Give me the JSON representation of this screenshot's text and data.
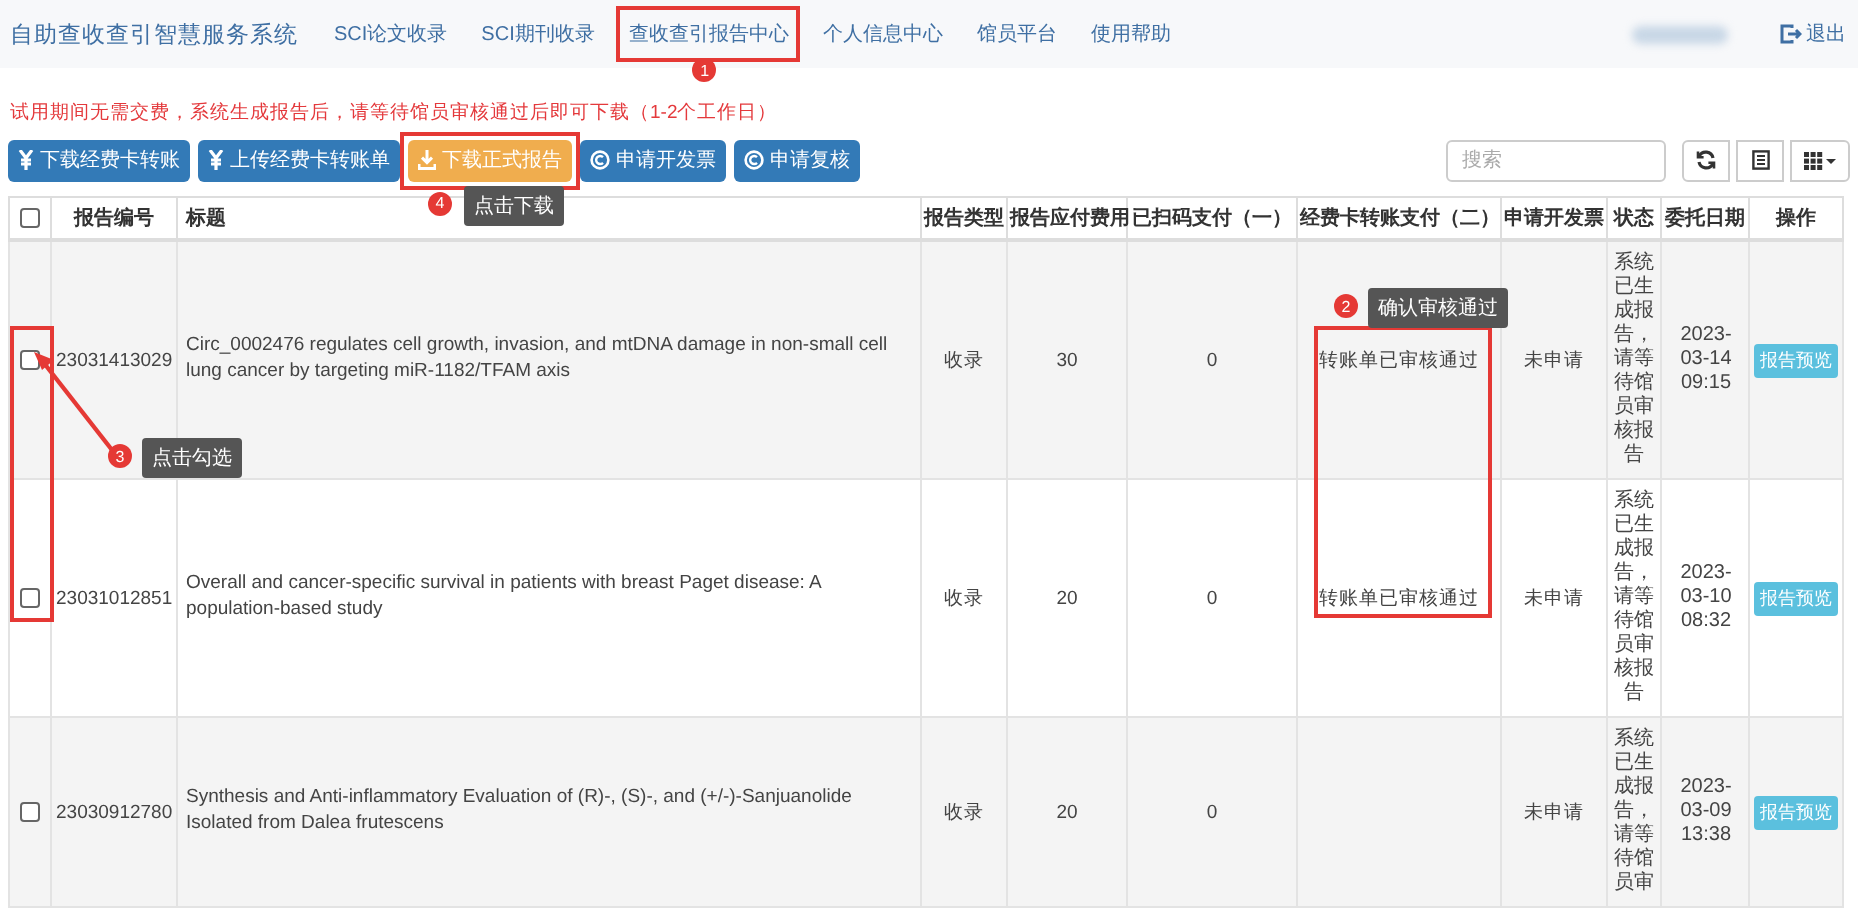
{
  "navbar": {
    "brand": "自助查收查引智慧服务系统",
    "items": [
      {
        "label": "SCI论文收录"
      },
      {
        "label": "SCI期刊收录"
      },
      {
        "label": "查收查引报告中心",
        "annotation": {
          "number": "1"
        }
      },
      {
        "label": "个人信息中心"
      },
      {
        "label": "馆员平台"
      },
      {
        "label": "使用帮助"
      }
    ],
    "logout": "退出"
  },
  "notice": "试用期间无需交费，系统生成报告后，请等待馆员审核通过后即可下载（1-2个工作日）",
  "toolbar": {
    "buttons": [
      {
        "label": "下载经费卡转账",
        "kind": "yen",
        "color": "#337ab7"
      },
      {
        "label": "上传经费卡转账单",
        "kind": "yen",
        "color": "#337ab7"
      },
      {
        "label": "下载正式报告",
        "kind": "download",
        "color": "#f0ad4e",
        "annotation": {
          "number": "4",
          "tip": "点击下载"
        }
      },
      {
        "label": "申请开发票",
        "kind": "circle",
        "color": "#337ab7"
      },
      {
        "label": "申请复核",
        "kind": "circle",
        "color": "#337ab7"
      }
    ],
    "search": {
      "placeholder": "搜索"
    }
  },
  "table": {
    "header_checkbox": {
      "checked": false
    },
    "columns": [
      "报告编号",
      "标题",
      "报告类型",
      "报告应付费用",
      "已扫码支付（一）",
      "经费卡转账支付（二）",
      "申请开发票",
      "状态",
      "委托日期",
      "操作"
    ],
    "rows": [
      {
        "checked": false,
        "id": "23031413029",
        "title": "Circ_0002476 regulates cell growth, invasion, and mtDNA damage in non-small cell lung cancer by targeting miR-1182/TFAM axis",
        "type": "收录",
        "fee": "30",
        "scanned": "0",
        "transfer": "转账单已审核通过",
        "invoice": "未申请",
        "status": "系统已生成报告，请等待馆员审核报告",
        "date": "2023-03-14 09:15",
        "action": "报告预览"
      },
      {
        "checked": false,
        "id": "23031012851",
        "title": "Overall and cancer-specific survival in patients with breast Paget disease: A population-based study",
        "type": "收录",
        "fee": "20",
        "scanned": "0",
        "transfer": "转账单已审核通过",
        "invoice": "未申请",
        "status": "系统已生成报告，请等待馆员审核报告",
        "date": "2023-03-10 08:32",
        "action": "报告预览"
      },
      {
        "checked": false,
        "id": "23030912780",
        "title": "Synthesis and Anti-inflammatory Evaluation of (R)-, (S)-, and (+/-)-Sanjuanolide Isolated from Dalea frutescens",
        "type": "收录",
        "fee": "20",
        "scanned": "0",
        "invoice": "未申请",
        "status": "系统已生成报告，请等待馆员审",
        "date": "2023-03-09 13:38",
        "action": "报告预览"
      }
    ]
  },
  "annotations": [
    {
      "number": "2",
      "kind": "transfer",
      "tip": "确认审核通过"
    },
    {
      "number": "3",
      "kind": "checkbox",
      "tip": "点击勾选"
    }
  ]
}
